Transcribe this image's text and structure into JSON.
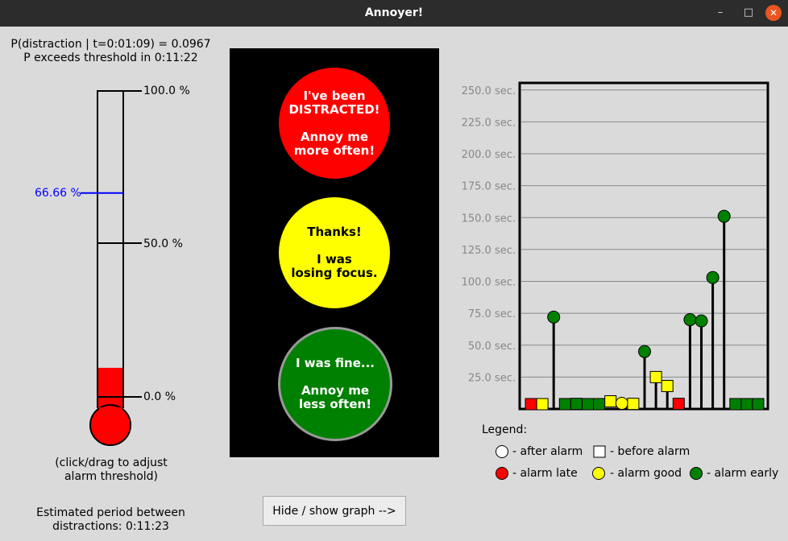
{
  "window": {
    "title": "Annoyer!",
    "minimize_glyph": "–",
    "maximize_glyph": "□",
    "close_glyph": "✕"
  },
  "status": {
    "probability_line": "P(distraction | t=0:01:09) = 0.0967",
    "threshold_line": "P exceeds threshold in 0:11:22"
  },
  "thermometer": {
    "label_100": "100.0 %",
    "label_50": "50.0 %",
    "label_0": "0.0 %",
    "threshold_label": "66.66 %",
    "threshold_value": 66.66,
    "fill_value": 9.5,
    "hint": "(click/drag to adjust\nalarm threshold)",
    "threshold_color": "#0000ff",
    "fill_color": "#ff0000"
  },
  "lights": {
    "red": {
      "text": "I've been\nDISTRACTED!\n\nAnnoy me\nmore often!",
      "color": "#ff0000"
    },
    "yellow": {
      "text": "Thanks!\n\nI  was\nlosing focus.",
      "color": "#ffff00"
    },
    "green": {
      "text": "I was fine...\n\nAnnoy me\nless often!",
      "color": "#008000"
    }
  },
  "estimate": {
    "text": "Estimated period between\ndistractions:  0:11:23"
  },
  "toggle_button": {
    "label": "Hide / show graph -->"
  },
  "legend": {
    "title": "Legend:",
    "after_alarm": "- after alarm",
    "before_alarm": "- before alarm",
    "alarm_late": "- alarm late",
    "alarm_good": "- alarm good",
    "alarm_early": "- alarm early"
  },
  "chart_data": {
    "type": "scatter",
    "ylim": [
      0,
      255
    ],
    "yticks": [
      25,
      50,
      75,
      100,
      125,
      150,
      175,
      200,
      225,
      250
    ],
    "ytick_labels": [
      "25.0 sec.",
      "50.0 sec.",
      "75.0 sec.",
      "100.0 sec.",
      "125.0 sec.",
      "150.0 sec.",
      "175.0 sec.",
      "200.0 sec.",
      "225.0 sec.",
      "250.0 sec."
    ],
    "grid": true,
    "colors": {
      "late": "#ff0000",
      "good": "#ffff00",
      "early": "#008000"
    },
    "points": [
      {
        "x": 1,
        "y": 2,
        "marker": "square",
        "status": "late"
      },
      {
        "x": 2,
        "y": 1,
        "marker": "square",
        "status": "good"
      },
      {
        "x": 3,
        "y": 72,
        "marker": "circle",
        "status": "early"
      },
      {
        "x": 4,
        "y": 0,
        "marker": "square",
        "status": "early"
      },
      {
        "x": 5,
        "y": 4,
        "marker": "square",
        "status": "early"
      },
      {
        "x": 6,
        "y": 0,
        "marker": "square",
        "status": "early"
      },
      {
        "x": 7,
        "y": 0,
        "marker": "square",
        "status": "early"
      },
      {
        "x": 8,
        "y": 6,
        "marker": "square",
        "status": "good"
      },
      {
        "x": 9,
        "y": 3,
        "marker": "circle",
        "status": "good"
      },
      {
        "x": 10,
        "y": 4,
        "marker": "square",
        "status": "good"
      },
      {
        "x": 11,
        "y": 45,
        "marker": "circle",
        "status": "early"
      },
      {
        "x": 12,
        "y": 25,
        "marker": "square",
        "status": "good"
      },
      {
        "x": 13,
        "y": 18,
        "marker": "square",
        "status": "good"
      },
      {
        "x": 14,
        "y": 4,
        "marker": "square",
        "status": "late"
      },
      {
        "x": 15,
        "y": 70,
        "marker": "circle",
        "status": "early"
      },
      {
        "x": 16,
        "y": 69,
        "marker": "circle",
        "status": "early"
      },
      {
        "x": 17,
        "y": 103,
        "marker": "circle",
        "status": "early"
      },
      {
        "x": 18,
        "y": 151,
        "marker": "circle",
        "status": "early"
      },
      {
        "x": 19,
        "y": 0,
        "marker": "square",
        "status": "early"
      },
      {
        "x": 20,
        "y": 0,
        "marker": "square",
        "status": "early"
      },
      {
        "x": 21,
        "y": 0,
        "marker": "square",
        "status": "early"
      }
    ]
  }
}
